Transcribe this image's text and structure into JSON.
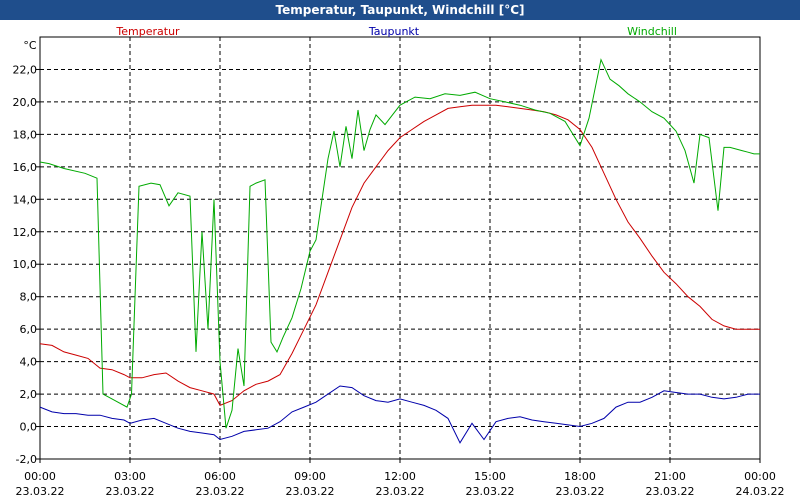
{
  "window": {
    "title": "Temperatur, Taupunkt, Windchill [°C]"
  },
  "chart_data": {
    "type": "line",
    "title": "Temperatur, Taupunkt, Windchill [°C]",
    "ylabel": "°C",
    "xlabel": "",
    "ylim": [
      -2.0,
      24.0
    ],
    "xlim_hours": [
      0,
      24
    ],
    "grid": true,
    "legend_position": "top",
    "yticks": [
      "-2,0",
      "0,0",
      "2,0",
      "4,0",
      "6,0",
      "8,0",
      "10,0",
      "12,0",
      "14,0",
      "16,0",
      "18,0",
      "20,0",
      "22,0"
    ],
    "yticks_values": [
      -2,
      0,
      2,
      4,
      6,
      8,
      10,
      12,
      14,
      16,
      18,
      20,
      22
    ],
    "xticks_time": [
      "00:00",
      "03:00",
      "06:00",
      "09:00",
      "12:00",
      "15:00",
      "18:00",
      "21:00",
      "00:00"
    ],
    "xticks_date": [
      "23.03.22",
      "23.03.22",
      "23.03.22",
      "23.03.22",
      "23.03.22",
      "23.03.22",
      "23.03.22",
      "23.03.22",
      "24.03.22"
    ],
    "series": [
      {
        "name": "Temperatur",
        "color": "#cc0000",
        "x": [
          0,
          0.4,
          0.8,
          1.2,
          1.6,
          2.0,
          2.4,
          2.8,
          3.0,
          3.4,
          3.8,
          4.2,
          4.6,
          5.0,
          5.4,
          5.8,
          6.0,
          6.4,
          6.8,
          7.2,
          7.6,
          8.0,
          8.4,
          8.8,
          9.2,
          9.6,
          10.0,
          10.4,
          10.8,
          11.2,
          11.6,
          12.0,
          12.4,
          12.8,
          13.2,
          13.6,
          14.0,
          14.4,
          14.8,
          15.2,
          15.6,
          16.0,
          16.4,
          16.8,
          17.2,
          17.6,
          18.0,
          18.4,
          18.8,
          19.2,
          19.6,
          20.0,
          20.4,
          20.8,
          21.2,
          21.6,
          22.0,
          22.4,
          22.8,
          23.2,
          23.6,
          24.0
        ],
        "values": [
          5.1,
          5.0,
          4.6,
          4.4,
          4.2,
          3.6,
          3.5,
          3.2,
          3.0,
          3.0,
          3.2,
          3.3,
          2.8,
          2.4,
          2.2,
          2.0,
          1.3,
          1.6,
          2.2,
          2.6,
          2.8,
          3.2,
          4.5,
          6.0,
          7.5,
          9.5,
          11.5,
          13.5,
          15.0,
          16.0,
          17.0,
          17.8,
          18.3,
          18.8,
          19.2,
          19.6,
          19.7,
          19.8,
          19.8,
          19.8,
          19.7,
          19.6,
          19.5,
          19.4,
          19.2,
          18.9,
          18.3,
          17.2,
          15.6,
          14.0,
          12.6,
          11.6,
          10.5,
          9.5,
          8.8,
          8.0,
          7.4,
          6.6,
          6.2,
          6.0,
          6.0,
          6.0
        ]
      },
      {
        "name": "Taupunkt",
        "color": "#0000aa",
        "x": [
          0,
          0.4,
          0.8,
          1.2,
          1.6,
          2.0,
          2.4,
          2.8,
          3.0,
          3.4,
          3.8,
          4.2,
          4.6,
          5.0,
          5.4,
          5.8,
          6.0,
          6.4,
          6.8,
          7.2,
          7.6,
          8.0,
          8.4,
          8.8,
          9.2,
          9.6,
          10.0,
          10.4,
          10.8,
          11.2,
          11.6,
          12.0,
          12.4,
          12.8,
          13.2,
          13.6,
          14.0,
          14.4,
          14.8,
          15.2,
          15.6,
          16.0,
          16.4,
          16.8,
          17.2,
          17.6,
          18.0,
          18.4,
          18.8,
          19.2,
          19.6,
          20.0,
          20.4,
          20.8,
          21.2,
          21.6,
          22.0,
          22.4,
          22.8,
          23.2,
          23.6,
          24.0
        ],
        "values": [
          1.2,
          0.9,
          0.8,
          0.8,
          0.7,
          0.7,
          0.5,
          0.4,
          0.2,
          0.4,
          0.5,
          0.2,
          -0.1,
          -0.3,
          -0.4,
          -0.5,
          -0.8,
          -0.6,
          -0.3,
          -0.2,
          -0.1,
          0.3,
          0.9,
          1.2,
          1.5,
          2.0,
          2.5,
          2.4,
          1.9,
          1.6,
          1.5,
          1.7,
          1.5,
          1.3,
          1.0,
          0.5,
          -1.0,
          0.2,
          -0.8,
          0.3,
          0.5,
          0.6,
          0.4,
          0.3,
          0.2,
          0.1,
          0.0,
          0.2,
          0.5,
          1.2,
          1.5,
          1.5,
          1.8,
          2.2,
          2.1,
          2.0,
          2.0,
          1.8,
          1.7,
          1.8,
          2.0,
          2.0
        ]
      },
      {
        "name": "Windchill",
        "color": "#00aa00",
        "x": [
          0,
          0.3,
          0.8,
          1.5,
          1.9,
          2.1,
          2.5,
          2.9,
          3.05,
          3.3,
          3.7,
          4.0,
          4.3,
          4.6,
          5.0,
          5.2,
          5.4,
          5.6,
          5.8,
          6.0,
          6.2,
          6.4,
          6.6,
          6.8,
          7.0,
          7.2,
          7.5,
          7.7,
          7.9,
          8.1,
          8.4,
          8.7,
          9.0,
          9.2,
          9.4,
          9.6,
          9.8,
          10.0,
          10.2,
          10.4,
          10.6,
          10.8,
          11.0,
          11.2,
          11.5,
          12.0,
          12.5,
          13.0,
          13.5,
          14.0,
          14.5,
          15.0,
          15.5,
          16.0,
          16.5,
          17.0,
          17.5,
          18.0,
          18.3,
          18.7,
          19.0,
          19.3,
          19.6,
          20.0,
          20.4,
          20.8,
          21.2,
          21.5,
          21.8,
          22.0,
          22.3,
          22.6,
          22.8,
          23.0,
          23.2,
          23.4,
          23.6,
          23.8,
          24.0
        ],
        "values": [
          16.3,
          16.2,
          15.9,
          15.6,
          15.3,
          2.0,
          1.6,
          1.2,
          2.0,
          14.8,
          15.0,
          14.9,
          13.6,
          14.4,
          14.2,
          4.6,
          12.0,
          6.0,
          14.0,
          4.0,
          -0.1,
          1.0,
          4.8,
          2.5,
          14.8,
          15.0,
          15.2,
          5.2,
          4.6,
          5.5,
          6.7,
          8.5,
          10.8,
          11.5,
          14.0,
          16.5,
          18.2,
          16.0,
          18.5,
          16.5,
          19.5,
          17.0,
          18.3,
          19.2,
          18.6,
          19.8,
          20.3,
          20.2,
          20.5,
          20.4,
          20.6,
          20.2,
          20.0,
          19.8,
          19.5,
          19.3,
          18.8,
          17.3,
          19.0,
          22.6,
          21.4,
          21.0,
          20.5,
          20.0,
          19.4,
          19.0,
          18.2,
          17.0,
          15.0,
          18.0,
          17.8,
          13.3,
          17.2,
          17.2,
          17.1,
          17.0,
          16.9,
          16.8,
          16.8
        ]
      }
    ]
  }
}
